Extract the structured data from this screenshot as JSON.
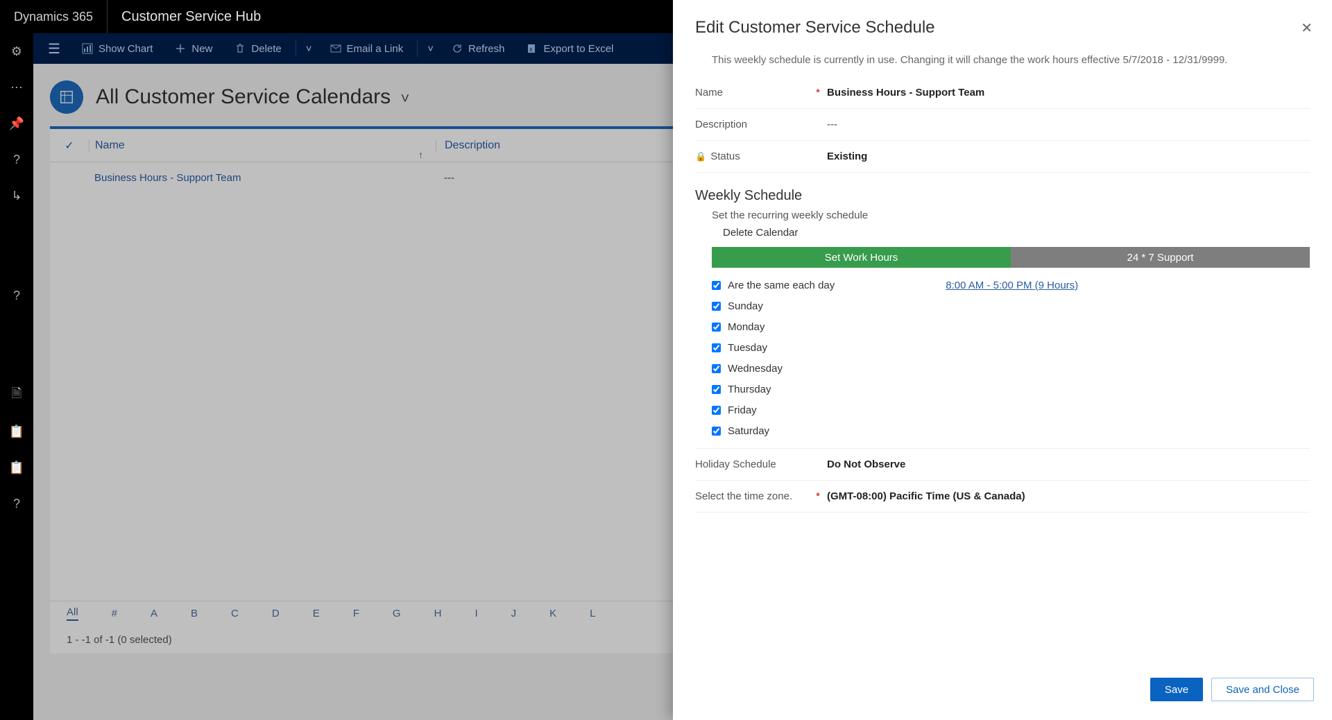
{
  "topbar": {
    "brand": "Dynamics 365",
    "appname": "Customer Service Hub"
  },
  "commands": {
    "show_chart": "Show Chart",
    "new": "New",
    "delete": "Delete",
    "email_link": "Email a Link",
    "refresh": "Refresh",
    "export_excel": "Export to Excel"
  },
  "page": {
    "title": "All Customer Service Calendars"
  },
  "grid": {
    "columns": {
      "name": "Name",
      "description": "Description"
    },
    "rows": [
      {
        "name": "Business Hours - Support Team",
        "description": "---"
      }
    ],
    "alpha": [
      "All",
      "#",
      "A",
      "B",
      "C",
      "D",
      "E",
      "F",
      "G",
      "H",
      "I",
      "J",
      "K",
      "L"
    ],
    "alpha_active": "All",
    "status": "1 - -1 of -1 (0 selected)"
  },
  "panel": {
    "title": "Edit Customer Service Schedule",
    "notice": "This weekly schedule is currently in use. Changing it will change the work hours effective 5/7/2018 - 12/31/9999.",
    "fields": {
      "name_label": "Name",
      "name_value": "Business Hours - Support Team",
      "description_label": "Description",
      "description_value": "---",
      "status_label": "Status",
      "status_value": "Existing",
      "holiday_label": "Holiday Schedule",
      "holiday_value": "Do Not Observe",
      "tz_label": "Select the time zone.",
      "tz_value": "(GMT-08:00) Pacific Time (US & Canada)"
    },
    "weekly": {
      "section_title": "Weekly Schedule",
      "sub": "Set the recurring weekly schedule",
      "delete": "Delete Calendar",
      "tab_work": "Set Work Hours",
      "tab_247": "24 * 7 Support",
      "same_each_day": "Are the same each day",
      "hours": "8:00 AM - 5:00 PM (9 Hours)",
      "days": [
        "Sunday",
        "Monday",
        "Tuesday",
        "Wednesday",
        "Thursday",
        "Friday",
        "Saturday"
      ]
    },
    "buttons": {
      "save": "Save",
      "save_close": "Save and Close"
    }
  }
}
